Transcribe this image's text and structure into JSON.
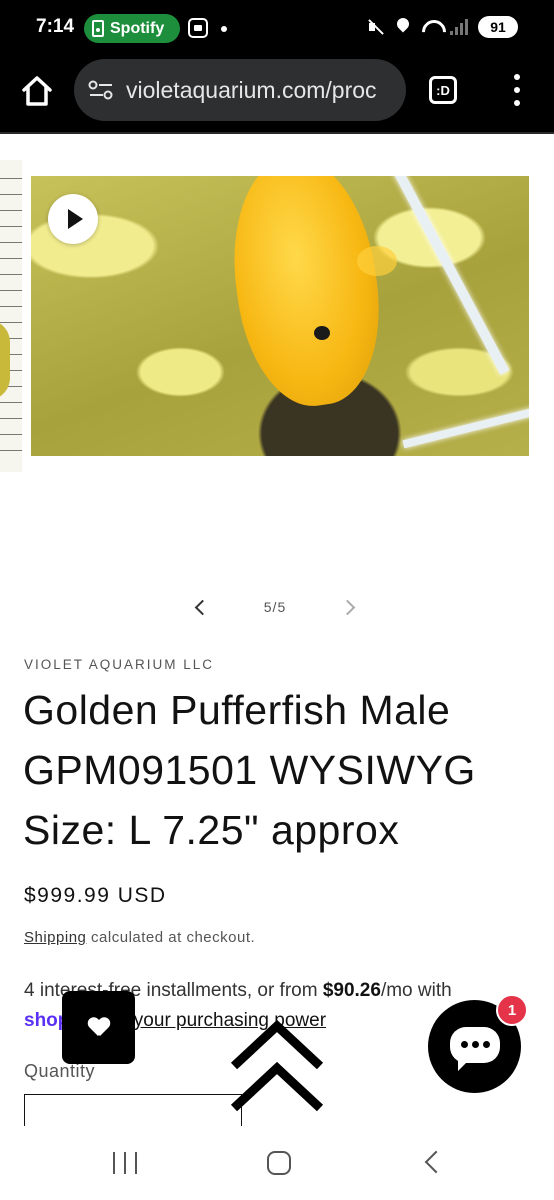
{
  "status_bar": {
    "time": "7:14",
    "spotify_label": "Spotify",
    "battery": "91"
  },
  "browser": {
    "url": "violetaquarium.com/proc",
    "tabs_label": ":D"
  },
  "gallery": {
    "counter": "5/5"
  },
  "product": {
    "vendor": "VIOLET AQUARIUM LLC",
    "title": "Golden Pufferfish Male GPM091501 WYSIWYG Size: L 7.25\" approx",
    "price": "$999.99 USD",
    "shipping_link": "Shipping",
    "shipping_text": " calculated at checkout.",
    "installments_prefix": "4 interest-free installments, or from ",
    "installments_amount": "$90.26",
    "installments_suffix": "/mo with ",
    "shop_pay_label": "shop",
    "check_link": "Check your purchasing power",
    "quantity_label": "Quantity"
  },
  "chat": {
    "badge": "1"
  }
}
